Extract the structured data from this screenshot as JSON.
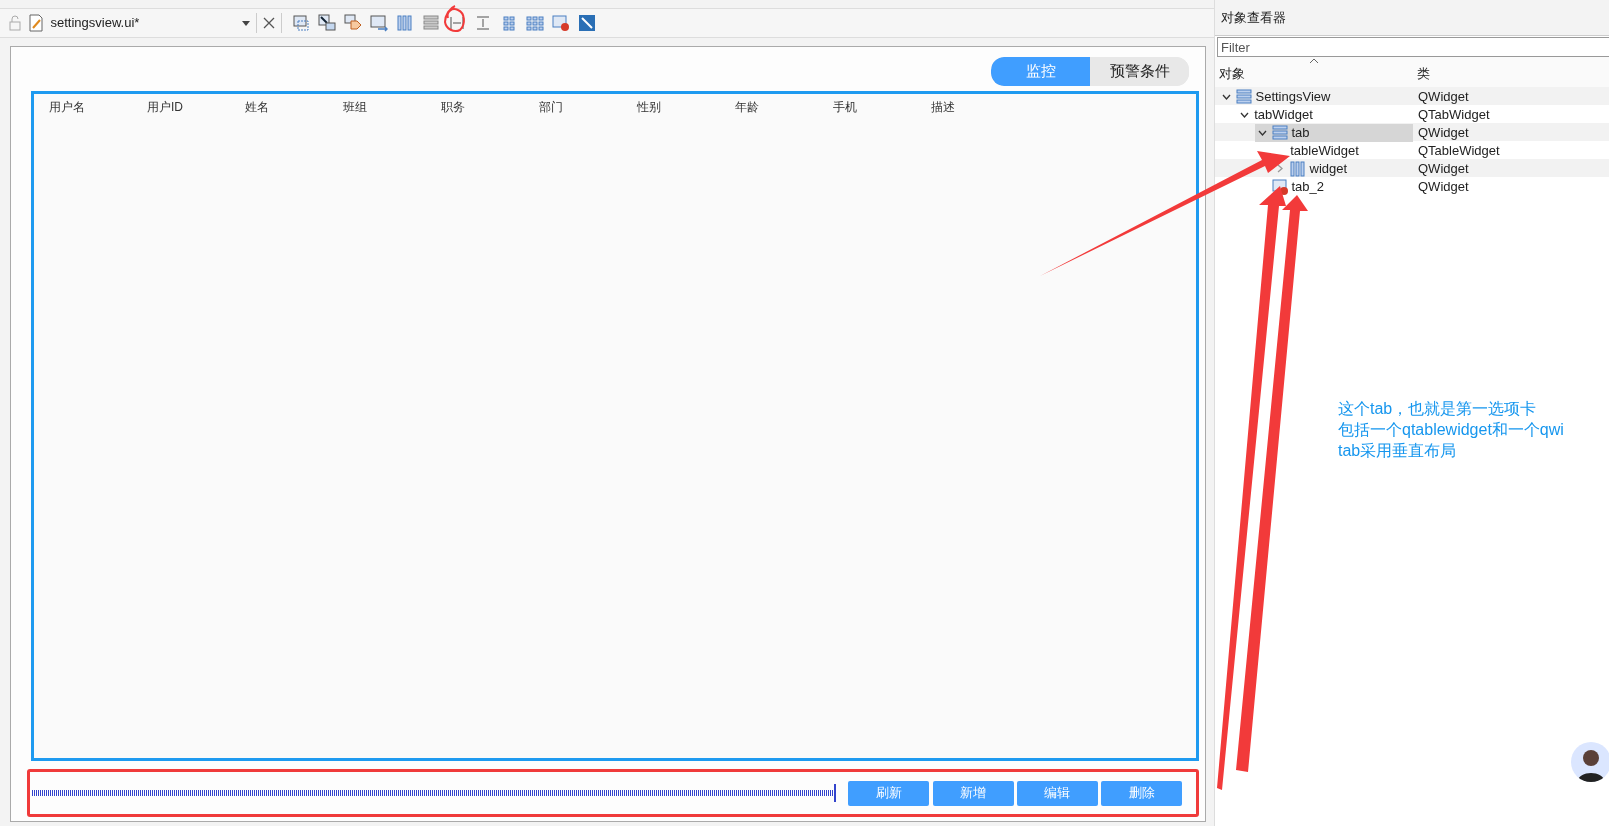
{
  "toolbar": {
    "file_name": "settingsview.ui*"
  },
  "tabs": [
    {
      "label": "监控",
      "selected": true
    },
    {
      "label": "预警条件",
      "selected": false
    }
  ],
  "table": {
    "columns": [
      "用户名",
      "用户ID",
      "姓名",
      "班组",
      "职务",
      "部门",
      "性别",
      "年龄",
      "手机",
      "描述"
    ]
  },
  "buttons": [
    "刷新",
    "新增",
    "编辑",
    "删除"
  ],
  "object_inspector": {
    "title": "对象查看器",
    "filter": {
      "placeholder": "Filter"
    },
    "columns": [
      "对象",
      "类"
    ],
    "tree": [
      {
        "name": "SettingsView",
        "class": "QWidget",
        "kind": "vertical",
        "expanded": true,
        "selected": false,
        "children": [
          {
            "name": "tabWidget",
            "class": "QTabWidget",
            "expanded": true,
            "selected": false,
            "children": [
              {
                "name": "tab",
                "class": "QWidget",
                "kind": "vertical",
                "expanded": true,
                "selected": true,
                "children": [
                  {
                    "name": "tableWidget",
                    "class": "QTableWidget",
                    "selected": false
                  },
                  {
                    "name": "widget",
                    "class": "QWidget",
                    "kind": "horizontal",
                    "expanded": false,
                    "selected": false
                  }
                ]
              },
              {
                "name": "tab_2",
                "class": "QWidget",
                "kind": "broken",
                "selected": false
              }
            ]
          }
        ]
      }
    ]
  },
  "annotation": {
    "lines": [
      "这个tab，也就是第一选项卡",
      "包括一个qtablewidget和一个qwi",
      "tab采用垂直布局"
    ]
  }
}
